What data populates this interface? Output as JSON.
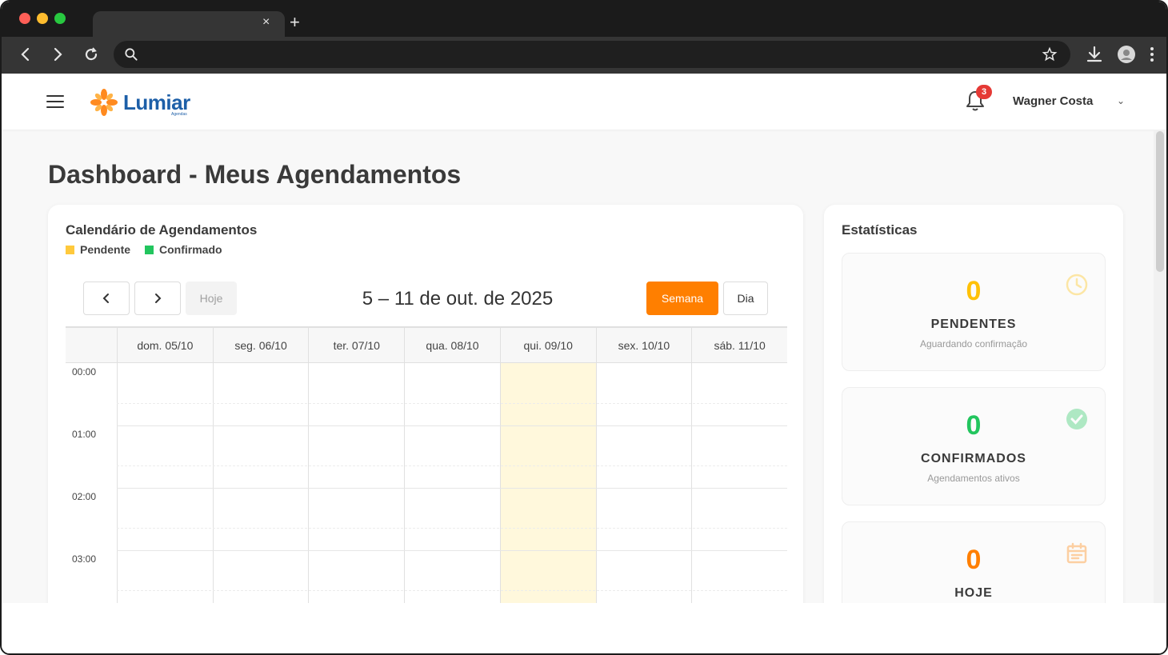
{
  "browser": {
    "tab_close": "×",
    "tab_new": "+",
    "nav": {
      "back": "‹",
      "forward": "›",
      "reload": "↻",
      "search": "⌕",
      "star": "☆",
      "download": "⤓",
      "menu": "⋮"
    }
  },
  "header": {
    "logo_text": "Lumiar",
    "logo_sub": "Agendas",
    "notifications_count": "3",
    "user_name": "Wagner Costa",
    "user_caret": "⌄"
  },
  "page": {
    "title": "Dashboard - Meus Agendamentos"
  },
  "calendar": {
    "title": "Calendário de Agendamentos",
    "legend": [
      {
        "label": "Pendente",
        "color": "#ffc93c"
      },
      {
        "label": "Confirmado",
        "color": "#22c55e"
      }
    ],
    "prev_label": "‹",
    "next_label": "›",
    "today_label": "Hoje",
    "range": "5 – 11 de out. de 2025",
    "week_label": "Semana",
    "day_label": "Dia",
    "days": [
      "dom. 05/10",
      "seg. 06/10",
      "ter. 07/10",
      "qua. 08/10",
      "qui. 09/10",
      "sex. 10/10",
      "sáb. 11/10"
    ],
    "today_index": 4,
    "times": [
      "00:00",
      "01:00",
      "02:00",
      "03:00"
    ]
  },
  "stats": {
    "title": "Estatísticas",
    "items": [
      {
        "value": "0",
        "label": "PENDENTES",
        "desc": "Aguardando confirmação",
        "color": "#ffc107",
        "icon": "clock-icon"
      },
      {
        "value": "0",
        "label": "CONFIRMADOS",
        "desc": "Agendamentos ativos",
        "color": "#22c55e",
        "icon": "check-circle-icon"
      },
      {
        "value": "0",
        "label": "HOJE",
        "desc": "",
        "color": "#ff7f00",
        "icon": "calendar-icon"
      }
    ]
  },
  "colors": {
    "accent": "#ff7f00",
    "brand_blue": "#1d5fa8",
    "today_column": "#fff8dc",
    "badge": "#e53935"
  }
}
